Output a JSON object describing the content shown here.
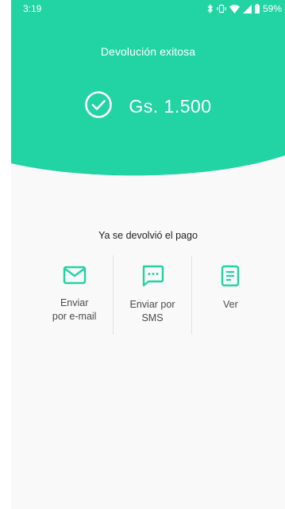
{
  "status_bar": {
    "time": "3:19",
    "battery": "59%",
    "icons": [
      "bluetooth-icon",
      "vibrate-icon",
      "wifi-icon",
      "signal-icon",
      "battery-icon"
    ]
  },
  "header": {
    "title": "Devolución exitosa",
    "amount": "Gs. 1.500",
    "status_icon": "check-circle-icon",
    "accent_color": "#22d3a4"
  },
  "message": "Ya se devolvió el pago",
  "actions": [
    {
      "label": "Enviar\npor e-mail",
      "icon": "mail-icon"
    },
    {
      "label": "Enviar por\nSMS",
      "icon": "sms-icon"
    },
    {
      "label": "Ver",
      "icon": "receipt-icon"
    }
  ]
}
